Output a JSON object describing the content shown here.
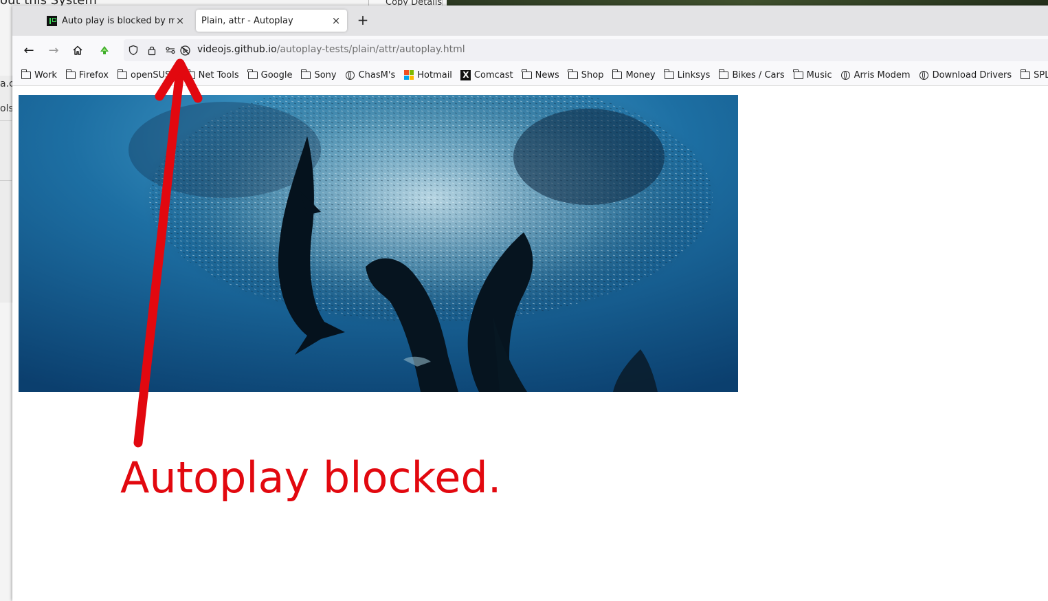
{
  "background_window": {
    "title_partial": "out this System",
    "copy_button": "Copy Details",
    "left_text_1": "a.c",
    "left_text_2": "ols"
  },
  "tabs": [
    {
      "title": "Auto play is blocked by my",
      "close": "×",
      "active": false
    },
    {
      "title": "Plain, attr - Autoplay",
      "close": "×",
      "active": true
    }
  ],
  "new_tab": "+",
  "nav": {
    "back": "←",
    "forward": "→",
    "home": "⌂"
  },
  "url": {
    "host": "videojs.github.io",
    "path": "/autoplay-tests/plain/attr/autoplay.html"
  },
  "bookmarks": [
    {
      "label": "Work",
      "icon": "folder"
    },
    {
      "label": "Firefox",
      "icon": "folder"
    },
    {
      "label": "openSUSE",
      "icon": "folder"
    },
    {
      "label": "Net Tools",
      "icon": "folder"
    },
    {
      "label": "Google",
      "icon": "folder"
    },
    {
      "label": "Sony",
      "icon": "folder"
    },
    {
      "label": "ChasM's",
      "icon": "globe"
    },
    {
      "label": "Hotmail",
      "icon": "microsoft"
    },
    {
      "label": "Comcast",
      "icon": "x-logo"
    },
    {
      "label": "News",
      "icon": "folder"
    },
    {
      "label": "Shop",
      "icon": "folder"
    },
    {
      "label": "Money",
      "icon": "folder"
    },
    {
      "label": "Linksys",
      "icon": "folder"
    },
    {
      "label": "Bikes / Cars",
      "icon": "folder"
    },
    {
      "label": "Music",
      "icon": "folder"
    },
    {
      "label": "Arris Modem",
      "icon": "globe"
    },
    {
      "label": "Download Drivers",
      "icon": "globe"
    },
    {
      "label": "SPLUNK",
      "icon": "folder"
    }
  ],
  "annotation": {
    "caption": "Autoplay blocked.",
    "color": "#e2080f"
  }
}
